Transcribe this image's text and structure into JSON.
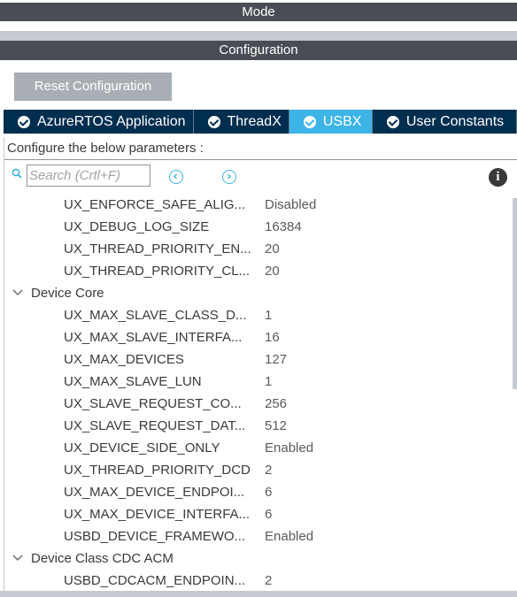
{
  "mode_header": {
    "title": "Mode"
  },
  "config_header": {
    "title": "Configuration"
  },
  "reset_button": {
    "label": "Reset Configuration"
  },
  "tabs": [
    {
      "label": "AzureRTOS Application",
      "active": false
    },
    {
      "label": "ThreadX",
      "active": false
    },
    {
      "label": "USBX",
      "active": true
    },
    {
      "label": "User Constants",
      "active": false
    }
  ],
  "panel": {
    "title": "Configure the below parameters :",
    "search_placeholder": "Search (Crtl+F)"
  },
  "tree": {
    "top_params": [
      {
        "name": "UX_ENFORCE_SAFE_ALIG...",
        "value": "Disabled"
      },
      {
        "name": "UX_DEBUG_LOG_SIZE",
        "value": "16384"
      },
      {
        "name": "UX_THREAD_PRIORITY_EN...",
        "value": "20"
      },
      {
        "name": "UX_THREAD_PRIORITY_CL...",
        "value": "20"
      }
    ],
    "group_device_core": "Device Core",
    "device_core_params": [
      {
        "name": "UX_MAX_SLAVE_CLASS_D...",
        "value": "1"
      },
      {
        "name": "UX_MAX_SLAVE_INTERFA...",
        "value": "16"
      },
      {
        "name": "UX_MAX_DEVICES",
        "value": "127"
      },
      {
        "name": "UX_MAX_SLAVE_LUN",
        "value": "1"
      },
      {
        "name": "UX_SLAVE_REQUEST_CO...",
        "value": "256"
      },
      {
        "name": "UX_SLAVE_REQUEST_DAT...",
        "value": "512"
      },
      {
        "name": "UX_DEVICE_SIDE_ONLY",
        "value": "Enabled"
      },
      {
        "name": "UX_THREAD_PRIORITY_DCD",
        "value": "2"
      },
      {
        "name": "UX_MAX_DEVICE_ENDPOI...",
        "value": "6"
      },
      {
        "name": "UX_MAX_DEVICE_INTERFA...",
        "value": "6"
      },
      {
        "name": "USBD_DEVICE_FRAMEWO...",
        "value": "Enabled"
      }
    ],
    "group_cdc_acm": "Device Class CDC ACM",
    "cdc_acm_params": [
      {
        "name": "USBD_CDCACM_ENDPOIN...",
        "value": "2"
      }
    ]
  },
  "colors": {
    "header_bg": "#4a4d55",
    "tab_bar_bg": "#002e4f",
    "tab_active_bg": "#3cb4e5",
    "button_bg": "#a9aeb4"
  },
  "icons": [
    "check-circle-icon",
    "search-icon",
    "previous-icon",
    "next-icon",
    "info-icon",
    "chevron-down-icon"
  ]
}
